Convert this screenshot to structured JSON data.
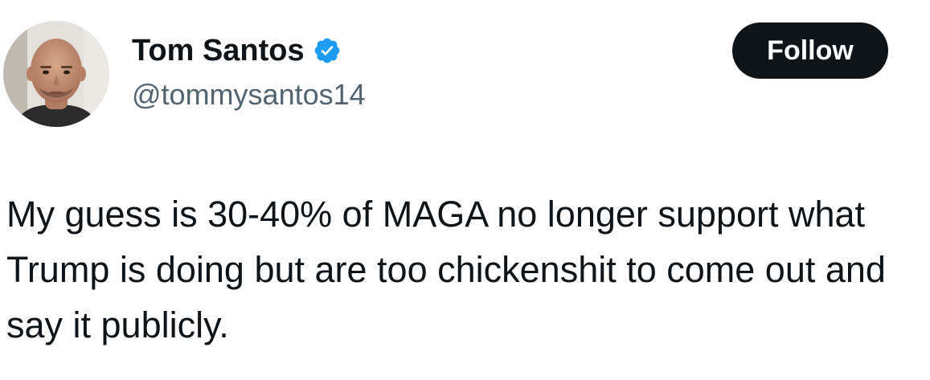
{
  "author": {
    "display_name": "Tom Santos",
    "handle": "@tommysantos14",
    "verified": true,
    "verified_color": "#1d9bf0",
    "avatar_icon": "profile-photo"
  },
  "follow_button": {
    "label": "Follow",
    "background": "#0f1419",
    "text_color": "#ffffff"
  },
  "tweet": {
    "text": "My guess is 30-40% of MAGA no longer support what Trump is doing but are too chickenshit to come out and say it publicly."
  }
}
